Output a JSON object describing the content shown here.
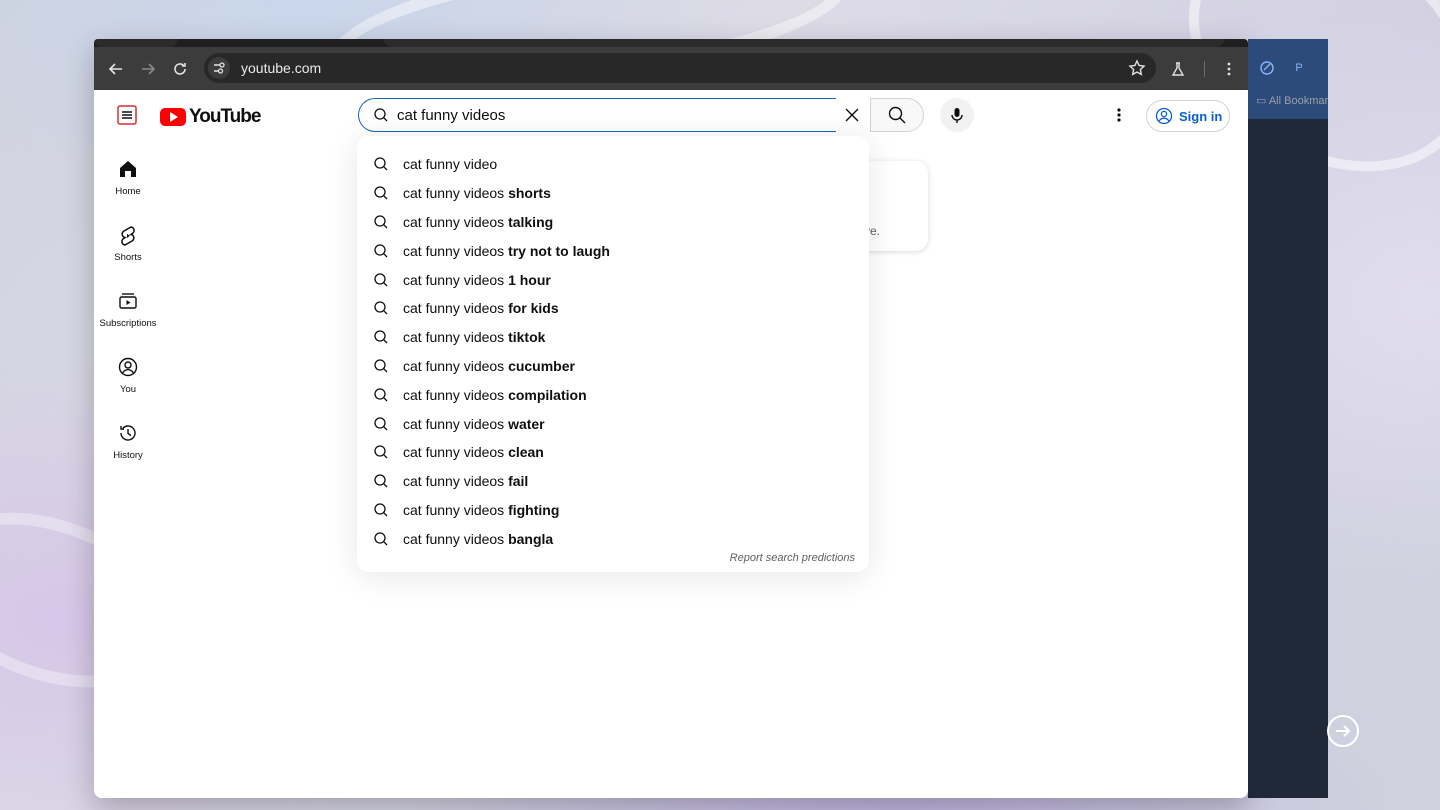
{
  "browser": {
    "url": "youtube.com",
    "sidepanel_profile": "P",
    "bookmarks_label": "All Bookmar"
  },
  "youtube": {
    "logo_text": "YouTube",
    "search": {
      "value": "cat funny videos",
      "placeholder": "Search"
    },
    "signin_label": "Sign in",
    "rail": [
      {
        "label": "Home",
        "icon": "home-icon"
      },
      {
        "label": "Shorts",
        "icon": "shorts-icon"
      },
      {
        "label": "Subscriptions",
        "icon": "subscriptions-icon"
      },
      {
        "label": "You",
        "icon": "you-icon"
      },
      {
        "label": "History",
        "icon": "history-icon"
      }
    ],
    "background_card_text": "ve.",
    "suggestions": [
      {
        "prefix": "cat funny video",
        "suffix": ""
      },
      {
        "prefix": "cat funny videos ",
        "suffix": "shorts"
      },
      {
        "prefix": "cat funny videos ",
        "suffix": "talking"
      },
      {
        "prefix": "cat funny videos ",
        "suffix": "try not to laugh"
      },
      {
        "prefix": "cat funny videos ",
        "suffix": "1 hour"
      },
      {
        "prefix": "cat funny videos ",
        "suffix": "for kids"
      },
      {
        "prefix": "cat funny videos ",
        "suffix": "tiktok"
      },
      {
        "prefix": "cat funny videos ",
        "suffix": "cucumber"
      },
      {
        "prefix": "cat funny videos ",
        "suffix": "compilation"
      },
      {
        "prefix": "cat funny videos ",
        "suffix": "water"
      },
      {
        "prefix": "cat funny videos ",
        "suffix": "clean"
      },
      {
        "prefix": "cat funny videos ",
        "suffix": "fail"
      },
      {
        "prefix": "cat funny videos ",
        "suffix": "fighting"
      },
      {
        "prefix": "cat funny videos ",
        "suffix": "bangla"
      }
    ],
    "report_label": "Report search predictions"
  }
}
